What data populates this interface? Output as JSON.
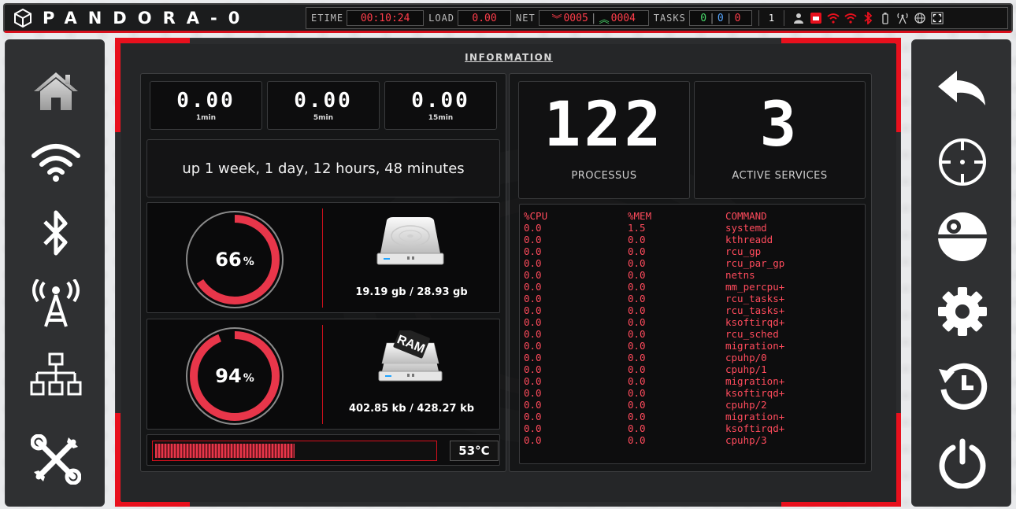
{
  "app": {
    "title": "PANDORA-0"
  },
  "status": {
    "etime_label": "ETIME",
    "etime": "00:10:24",
    "load_label": "LOAD",
    "load": "0.00",
    "net_label": "NET",
    "net_down": "0005",
    "net_up": "0004",
    "tasks_label": "TASKS",
    "tasks": [
      "0",
      "0",
      "0"
    ],
    "user_count": "1",
    "icons": [
      "user-icon",
      "server-icon",
      "wifi-icon",
      "wifi-alt-icon",
      "bluetooth-icon",
      "battery-icon",
      "antenna-icon",
      "globe-icon",
      "fullscreen-icon"
    ]
  },
  "left_nav": [
    "home-icon",
    "wifi-icon",
    "bluetooth-icon",
    "antenna-icon",
    "network-icon",
    "tools-icon"
  ],
  "right_nav": [
    "undo-icon",
    "crosshair-icon",
    "deathstar-icon",
    "gear-icon",
    "history-icon",
    "power-icon"
  ],
  "info": {
    "title": "INFORMATION",
    "load": [
      {
        "value": "0.00",
        "label": "1min"
      },
      {
        "value": "0.00",
        "label": "5min"
      },
      {
        "value": "0.00",
        "label": "15min"
      }
    ],
    "uptime": "up 1 week, 1 day, 12 hours, 48 minutes",
    "disk": {
      "percent": 66,
      "pct_sign": "%",
      "usage": "19.19 gb / 28.93 gb"
    },
    "ram": {
      "percent": 94,
      "pct_sign": "%",
      "usage": "402.85 kb / 428.27 kb",
      "chip_label": "RAM"
    },
    "temperature": {
      "value": "53°C",
      "level": 0.5
    },
    "processes": {
      "value": "122",
      "label": "PROCESSUS"
    },
    "services": {
      "value": "3",
      "label": "ACTIVE SERVICES"
    },
    "colors": {
      "accent": "#e8101d",
      "gauge": "#e8364a",
      "table_text": "#ff4b5c"
    }
  },
  "proc_table": {
    "headers": [
      "%CPU",
      "%MEM",
      "COMMAND"
    ],
    "rows": [
      [
        "0.0",
        "1.5",
        "systemd"
      ],
      [
        "0.0",
        "0.0",
        "kthreadd"
      ],
      [
        "0.0",
        "0.0",
        "rcu_gp"
      ],
      [
        "0.0",
        "0.0",
        "rcu_par_gp"
      ],
      [
        "0.0",
        "0.0",
        "netns"
      ],
      [
        "0.0",
        "0.0",
        "mm_percpu+"
      ],
      [
        "0.0",
        "0.0",
        "rcu_tasks+"
      ],
      [
        "0.0",
        "0.0",
        "rcu_tasks+"
      ],
      [
        "0.0",
        "0.0",
        "ksoftirqd+"
      ],
      [
        "0.0",
        "0.0",
        "rcu_sched"
      ],
      [
        "0.0",
        "0.0",
        "migration+"
      ],
      [
        "0.0",
        "0.0",
        "cpuhp/0"
      ],
      [
        "0.0",
        "0.0",
        "cpuhp/1"
      ],
      [
        "0.0",
        "0.0",
        "migration+"
      ],
      [
        "0.0",
        "0.0",
        "ksoftirqd+"
      ],
      [
        "0.0",
        "0.0",
        "cpuhp/2"
      ],
      [
        "0.0",
        "0.0",
        "migration+"
      ],
      [
        "0.0",
        "0.0",
        "ksoftirqd+"
      ],
      [
        "0.0",
        "0.0",
        "cpuhp/3"
      ]
    ]
  }
}
